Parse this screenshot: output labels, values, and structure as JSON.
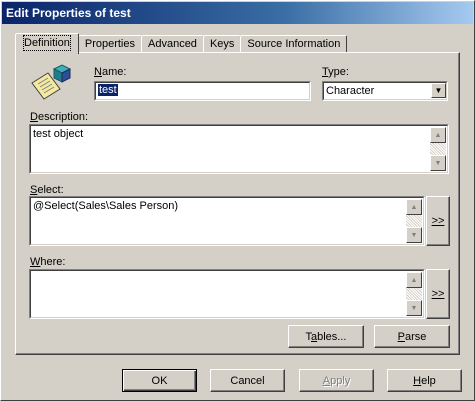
{
  "window": {
    "title": "Edit Properties of test"
  },
  "tabs": [
    {
      "label": "Definition",
      "active": true
    },
    {
      "label": "Properties",
      "active": false
    },
    {
      "label": "Advanced",
      "active": false
    },
    {
      "label": "Keys",
      "active": false
    },
    {
      "label": "Source Information",
      "active": false
    }
  ],
  "definition": {
    "icon": "object-definition-icon",
    "name_label_u": "N",
    "name_label_rest": "ame:",
    "name_value": "test",
    "type_label_u": "T",
    "type_label_rest": "ype:",
    "type_value": "Character",
    "description_label_u": "D",
    "description_label_rest": "escription:",
    "description_value": "test object",
    "select_label_u": "S",
    "select_label_rest": "elect:",
    "select_value": "@Select(Sales\\Sales Person)",
    "select_expand_label": ">>",
    "where_label_u": "W",
    "where_label_rest": "here:",
    "where_value": "",
    "where_expand_label": ">>",
    "tables_button_pre": "T",
    "tables_button_u": "a",
    "tables_button_rest": "bles...",
    "parse_button_u": "P",
    "parse_button_rest": "arse"
  },
  "footer": {
    "ok_label": "OK",
    "cancel_label": "Cancel",
    "apply_u": "A",
    "apply_rest": "pply",
    "apply_enabled": false,
    "help_u": "H",
    "help_rest": "elp"
  }
}
